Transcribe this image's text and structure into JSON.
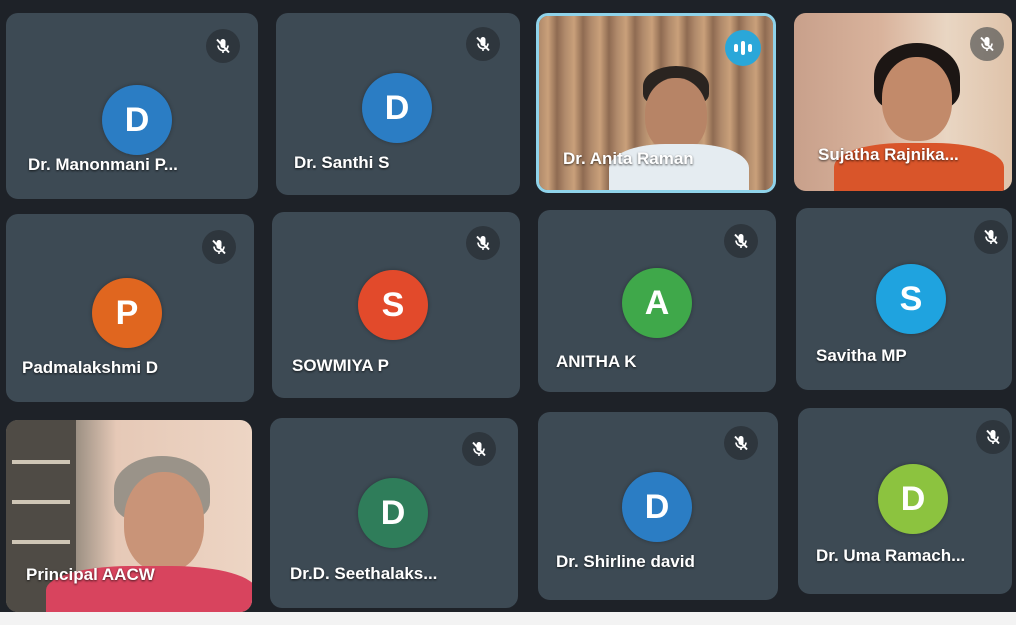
{
  "participants": [
    {
      "name": "Dr. Manonmani P...",
      "initial": "D",
      "avatar_color": "#2b7dc4",
      "muted": true,
      "video": false
    },
    {
      "name": "Dr. Santhi S",
      "initial": "D",
      "avatar_color": "#2b7dc4",
      "muted": true,
      "video": false
    },
    {
      "name": "Dr. Anita Raman",
      "initial": "",
      "avatar_color": "",
      "muted": false,
      "video": true,
      "speaking": true
    },
    {
      "name": "Sujatha Rajnika...",
      "initial": "",
      "avatar_color": "",
      "muted": true,
      "video": true
    },
    {
      "name": "Padmalakshmi D",
      "initial": "P",
      "avatar_color": "#e0661f",
      "muted": true,
      "video": false
    },
    {
      "name": "SOWMIYA P",
      "initial": "S",
      "avatar_color": "#e24a2b",
      "muted": true,
      "video": false
    },
    {
      "name": "ANITHA K",
      "initial": "A",
      "avatar_color": "#3fa84a",
      "muted": true,
      "video": false
    },
    {
      "name": "Savitha MP",
      "initial": "S",
      "avatar_color": "#1fa3df",
      "muted": true,
      "video": false
    },
    {
      "name": "Principal AACW",
      "initial": "",
      "avatar_color": "",
      "muted": false,
      "video": true
    },
    {
      "name": "Dr.D. Seethalaks...",
      "initial": "D",
      "avatar_color": "#2f7d5a",
      "muted": true,
      "video": false
    },
    {
      "name": "Dr. Shirline david",
      "initial": "D",
      "avatar_color": "#2b7dc4",
      "muted": true,
      "video": false
    },
    {
      "name": "Dr. Uma Ramach...",
      "initial": "D",
      "avatar_color": "#8cc33f",
      "muted": true,
      "video": false
    }
  ],
  "icons": {
    "muted": "mic-off-icon",
    "speaking": "speaking-indicator-icon"
  }
}
